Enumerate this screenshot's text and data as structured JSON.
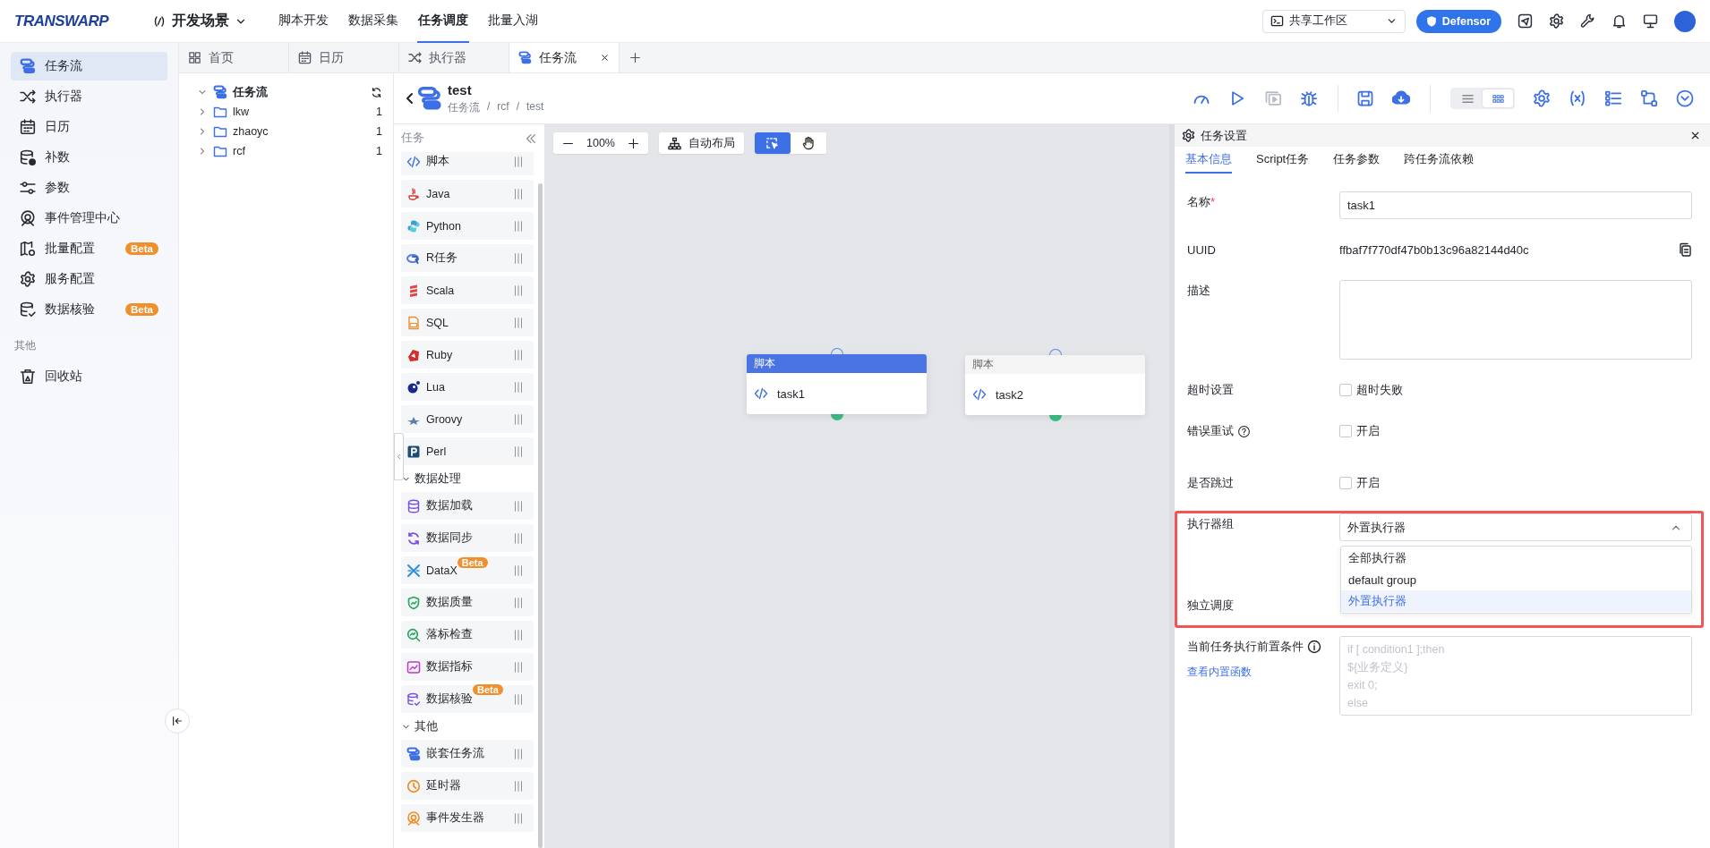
{
  "brand": {
    "logo": "TRANSWARP"
  },
  "scene": {
    "title": "开发场景"
  },
  "top_nav": [
    {
      "label": "脚本开发",
      "selected": false
    },
    {
      "label": "数据采集",
      "selected": false
    },
    {
      "label": "任务调度",
      "selected": true
    },
    {
      "label": "批量入湖",
      "selected": false
    }
  ],
  "workspace": {
    "value": "共享工作区"
  },
  "defensor": {
    "label": "Defensor"
  },
  "sidebar": {
    "items": [
      {
        "label": "任务流",
        "selected": true
      },
      {
        "label": "执行器",
        "selected": false
      },
      {
        "label": "日历",
        "selected": false
      },
      {
        "label": "补数",
        "selected": false
      },
      {
        "label": "参数",
        "selected": false
      },
      {
        "label": "事件管理中心",
        "selected": false
      },
      {
        "label": "批量配置",
        "selected": false,
        "badge": "Beta"
      },
      {
        "label": "服务配置",
        "selected": false
      },
      {
        "label": "数据核验",
        "selected": false,
        "badge": "Beta"
      }
    ],
    "section": "其他",
    "extra_items": [
      {
        "label": "回收站",
        "selected": false
      }
    ]
  },
  "tabs": [
    {
      "label": "首页",
      "selected": false,
      "closable": false
    },
    {
      "label": "日历",
      "selected": false,
      "closable": false
    },
    {
      "label": "执行器",
      "selected": false,
      "closable": false
    },
    {
      "label": "任务流",
      "selected": true,
      "closable": true
    }
  ],
  "tree": {
    "label": "任务流",
    "expanded": true,
    "children": [
      {
        "label": "lkw",
        "count": "1",
        "expanded": false
      },
      {
        "label": "zhaoyc",
        "count": "1",
        "expanded": false
      },
      {
        "label": "rcf",
        "count": "1",
        "expanded": false
      }
    ]
  },
  "workflow": {
    "title": "test",
    "breadcrumb": [
      "任务流",
      "rcf",
      "test"
    ],
    "breadcrumb_separator": "/",
    "view_modes": [
      {
        "kind": "list",
        "selected": false
      },
      {
        "kind": "grid",
        "selected": true
      }
    ]
  },
  "palette": {
    "title": "任务",
    "items": [
      {
        "label": "脚本"
      },
      {
        "label": "Java"
      },
      {
        "label": "Python"
      },
      {
        "label": "R任务"
      },
      {
        "label": "Scala"
      },
      {
        "label": "SQL"
      },
      {
        "label": "Ruby"
      },
      {
        "label": "Lua"
      },
      {
        "label": "Groovy"
      },
      {
        "label": "Perl"
      }
    ],
    "groups": [
      {
        "label": "数据处理",
        "expanded": true,
        "items": [
          {
            "label": "数据加载"
          },
          {
            "label": "数据同步"
          },
          {
            "label": "DataX",
            "badge": "Beta"
          },
          {
            "label": "数据质量"
          },
          {
            "label": "落标检查"
          },
          {
            "label": "数据指标"
          },
          {
            "label": "数据核验",
            "badge": "Beta"
          }
        ]
      },
      {
        "label": "其他",
        "expanded": true,
        "items": [
          {
            "label": "嵌套任务流"
          },
          {
            "label": "延时器"
          },
          {
            "label": "事件发生器"
          }
        ]
      }
    ]
  },
  "canvas": {
    "zoom": "100%",
    "auto_layout": "自动布局",
    "tools": [
      {
        "kind": "select",
        "selected": true
      },
      {
        "kind": "pan",
        "selected": false
      }
    ],
    "nodes": [
      {
        "type": "脚本",
        "name": "task1",
        "selected": true
      },
      {
        "type": "脚本",
        "name": "task2",
        "selected": false
      }
    ]
  },
  "task_settings": {
    "title": "任务设置",
    "highlight": true,
    "tabs": [
      {
        "label": "基本信息",
        "selected": true
      },
      {
        "label": "Script任务",
        "selected": false
      },
      {
        "label": "任务参数",
        "selected": false
      },
      {
        "label": "跨任务流依赖",
        "selected": false
      }
    ],
    "fields": [
      {
        "kind": "text",
        "label": "名称",
        "required_mark": "*",
        "value": "task1"
      },
      {
        "kind": "copy",
        "label": "UUID",
        "value": "ffbaf7f770df47b0b13c96a82144d40c"
      },
      {
        "kind": "textarea",
        "label": "描述"
      },
      {
        "kind": "checkbox",
        "label": "超时设置",
        "option": "超时失败",
        "checked": false
      },
      {
        "kind": "checkbox",
        "label": "错误重试",
        "help": true,
        "option": "开启",
        "checked": false
      },
      {
        "kind": "checkbox",
        "label": "是否跳过",
        "option": "开启",
        "checked": false
      },
      {
        "kind": "select",
        "label": "执行器组",
        "value": "外置执行器",
        "expanded": true,
        "options": [
          {
            "label": "全部执行器",
            "selected": false
          },
          {
            "label": "default group",
            "selected": false
          },
          {
            "label": "外置执行器",
            "selected": true
          }
        ]
      },
      {
        "kind": "covered",
        "label": "独立调度"
      },
      {
        "kind": "code",
        "label": "当前任务执行前置条件",
        "info": true,
        "link": "查看内置函数",
        "placeholder": "if [ condition1 ];then\n${业务定义}\nexit 0;\nelse"
      }
    ]
  }
}
